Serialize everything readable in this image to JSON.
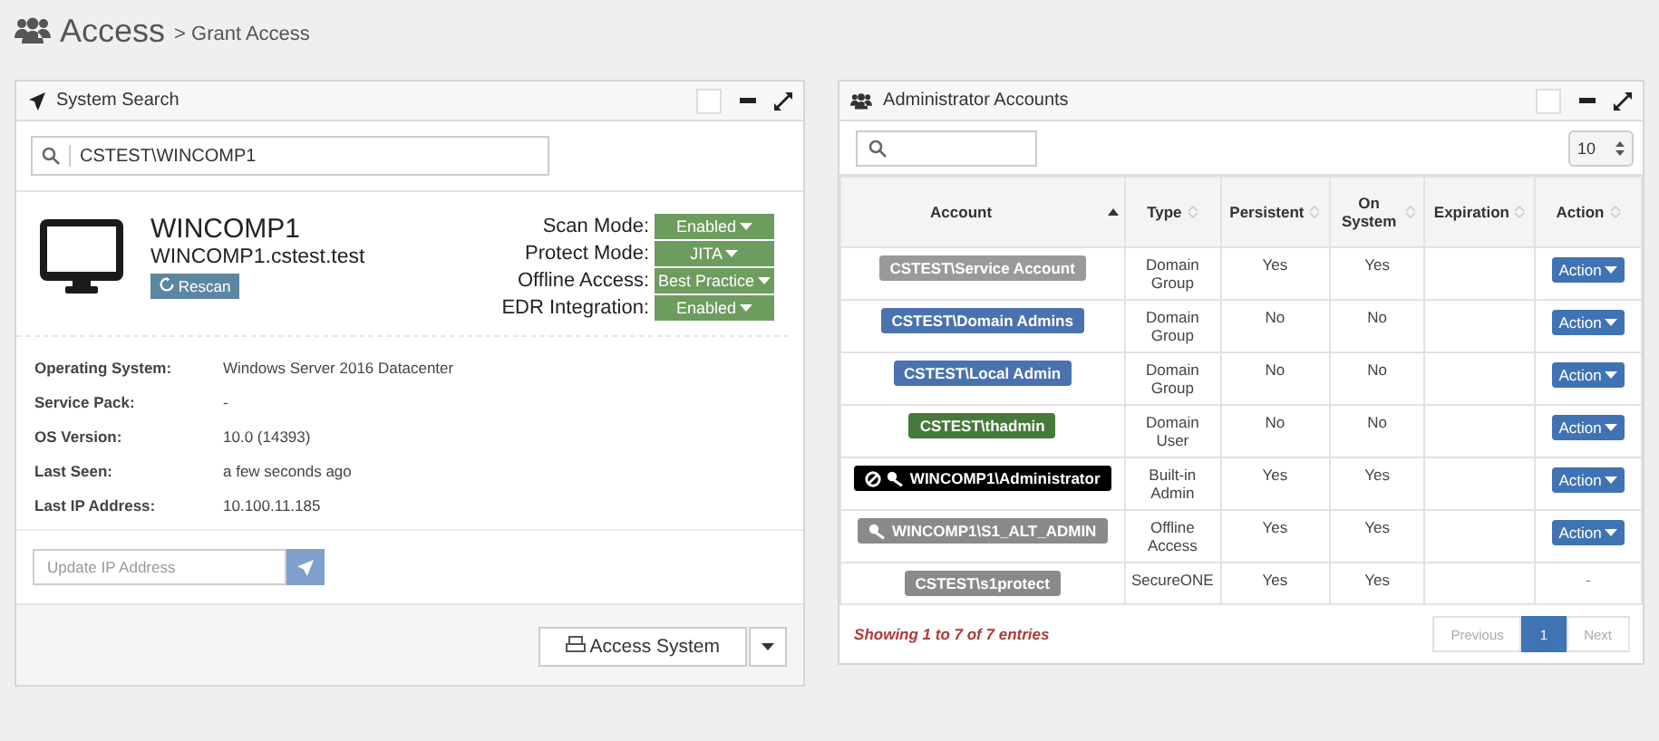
{
  "page": {
    "title": "Access",
    "subtitle": "> Grant Access"
  },
  "system_search": {
    "title": "System Search",
    "search_value": "CSTEST\\WINCOMP1",
    "system": {
      "name": "WINCOMP1",
      "fqdn": "WINCOMP1.cstest.test",
      "rescan_label": "Rescan"
    },
    "modes": [
      {
        "label": "Scan Mode:",
        "value": "Enabled"
      },
      {
        "label": "Protect Mode:",
        "value": "JITA"
      },
      {
        "label": "Offline Access:",
        "value": "Best Practice"
      },
      {
        "label": "EDR Integration:",
        "value": "Enabled"
      }
    ],
    "details": [
      {
        "label": "Operating System:",
        "value": "Windows Server 2016 Datacenter"
      },
      {
        "label": "Service Pack:",
        "value": "-"
      },
      {
        "label": "OS Version:",
        "value": "10.0 (14393)"
      },
      {
        "label": "Last Seen:",
        "value": "a few seconds ago"
      },
      {
        "label": "Last IP Address:",
        "value": "10.100.11.185"
      }
    ],
    "ip_field": {
      "placeholder": "Update IP Address"
    },
    "access_button": "Access System"
  },
  "admin_accounts": {
    "title": "Administrator Accounts",
    "page_size": "10",
    "columns": [
      {
        "label": "Account",
        "sorted": true
      },
      {
        "label": "Type",
        "sorted": false
      },
      {
        "label": "Persistent",
        "sorted": false
      },
      {
        "label": "On System",
        "sorted": false
      },
      {
        "label": "Expiration",
        "sorted": false
      },
      {
        "label": "Action",
        "sorted": false
      }
    ],
    "rows": [
      {
        "account": "CSTEST\\Service Account",
        "color": "#9a9a9a",
        "blocked": false,
        "key": false,
        "type": "Domain Group",
        "persistent": "Yes",
        "on_system": "Yes",
        "action": {
          "kind": "button",
          "label": "Action"
        }
      },
      {
        "account": "CSTEST\\Domain Admins",
        "color": "#4a72ae",
        "blocked": false,
        "key": false,
        "type": "Domain Group",
        "persistent": "No",
        "on_system": "No",
        "action": {
          "kind": "button",
          "label": "Action"
        }
      },
      {
        "account": "CSTEST\\Local Admin",
        "color": "#4a72ae",
        "blocked": false,
        "key": false,
        "type": "Domain Group",
        "persistent": "No",
        "on_system": "No",
        "action": {
          "kind": "button",
          "label": "Action"
        }
      },
      {
        "account": "CSTEST\\thadmin",
        "color": "#467a3a",
        "blocked": false,
        "key": false,
        "type": "Domain User",
        "persistent": "No",
        "on_system": "No",
        "action": {
          "kind": "button",
          "label": "Action"
        }
      },
      {
        "account": "WINCOMP1\\Administrator",
        "color": "#000000",
        "blocked": true,
        "key": true,
        "type": "Built-in Admin",
        "persistent": "Yes",
        "on_system": "Yes",
        "action": {
          "kind": "button",
          "label": "Action"
        }
      },
      {
        "account": "WINCOMP1\\S1_ALT_ADMIN",
        "color": "#8a8a8a",
        "blocked": false,
        "key": true,
        "type": "Offline Access",
        "persistent": "Yes",
        "on_system": "Yes",
        "action": {
          "kind": "button",
          "label": "Action"
        }
      },
      {
        "account": "CSTEST\\s1protect",
        "color": "#8a8a8a",
        "blocked": false,
        "key": false,
        "type": "SecureONE",
        "persistent": "Yes",
        "on_system": "Yes",
        "action": {
          "kind": "text",
          "label": "-"
        }
      }
    ],
    "info": "Showing 1 to 7 of 7 entries",
    "pagination": [
      {
        "label": "Previous",
        "selected": false
      },
      {
        "label": "1",
        "selected": true
      },
      {
        "label": "Next",
        "selected": false
      }
    ]
  }
}
